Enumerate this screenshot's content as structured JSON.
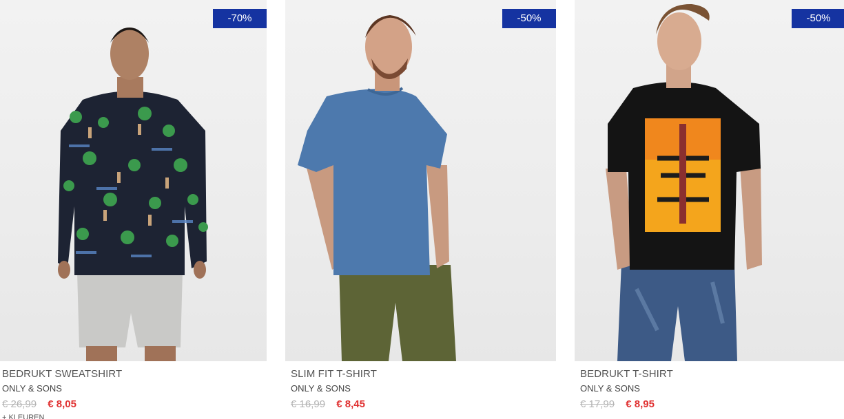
{
  "products": [
    {
      "title": "BEDRUKT SWEATSHIRT",
      "brand": "ONLY & SONS",
      "old_price": "€ 26,99",
      "new_price": "€ 8,05",
      "discount": "-70%",
      "extra_link": "+ KLEUREN"
    },
    {
      "title": "SLIM FIT T-SHIRT",
      "brand": "ONLY & SONS",
      "old_price": "€ 16,99",
      "new_price": "€ 8,45",
      "discount": "-50%"
    },
    {
      "title": "BEDRUKT T-SHIRT",
      "brand": "ONLY & SONS",
      "old_price": "€ 17,99",
      "new_price": "€ 8,95",
      "discount": "-50%"
    }
  ],
  "colors": {
    "badge_bg": "#1533a1",
    "sale_price": "#e03131",
    "old_price": "#b3b3b3"
  }
}
